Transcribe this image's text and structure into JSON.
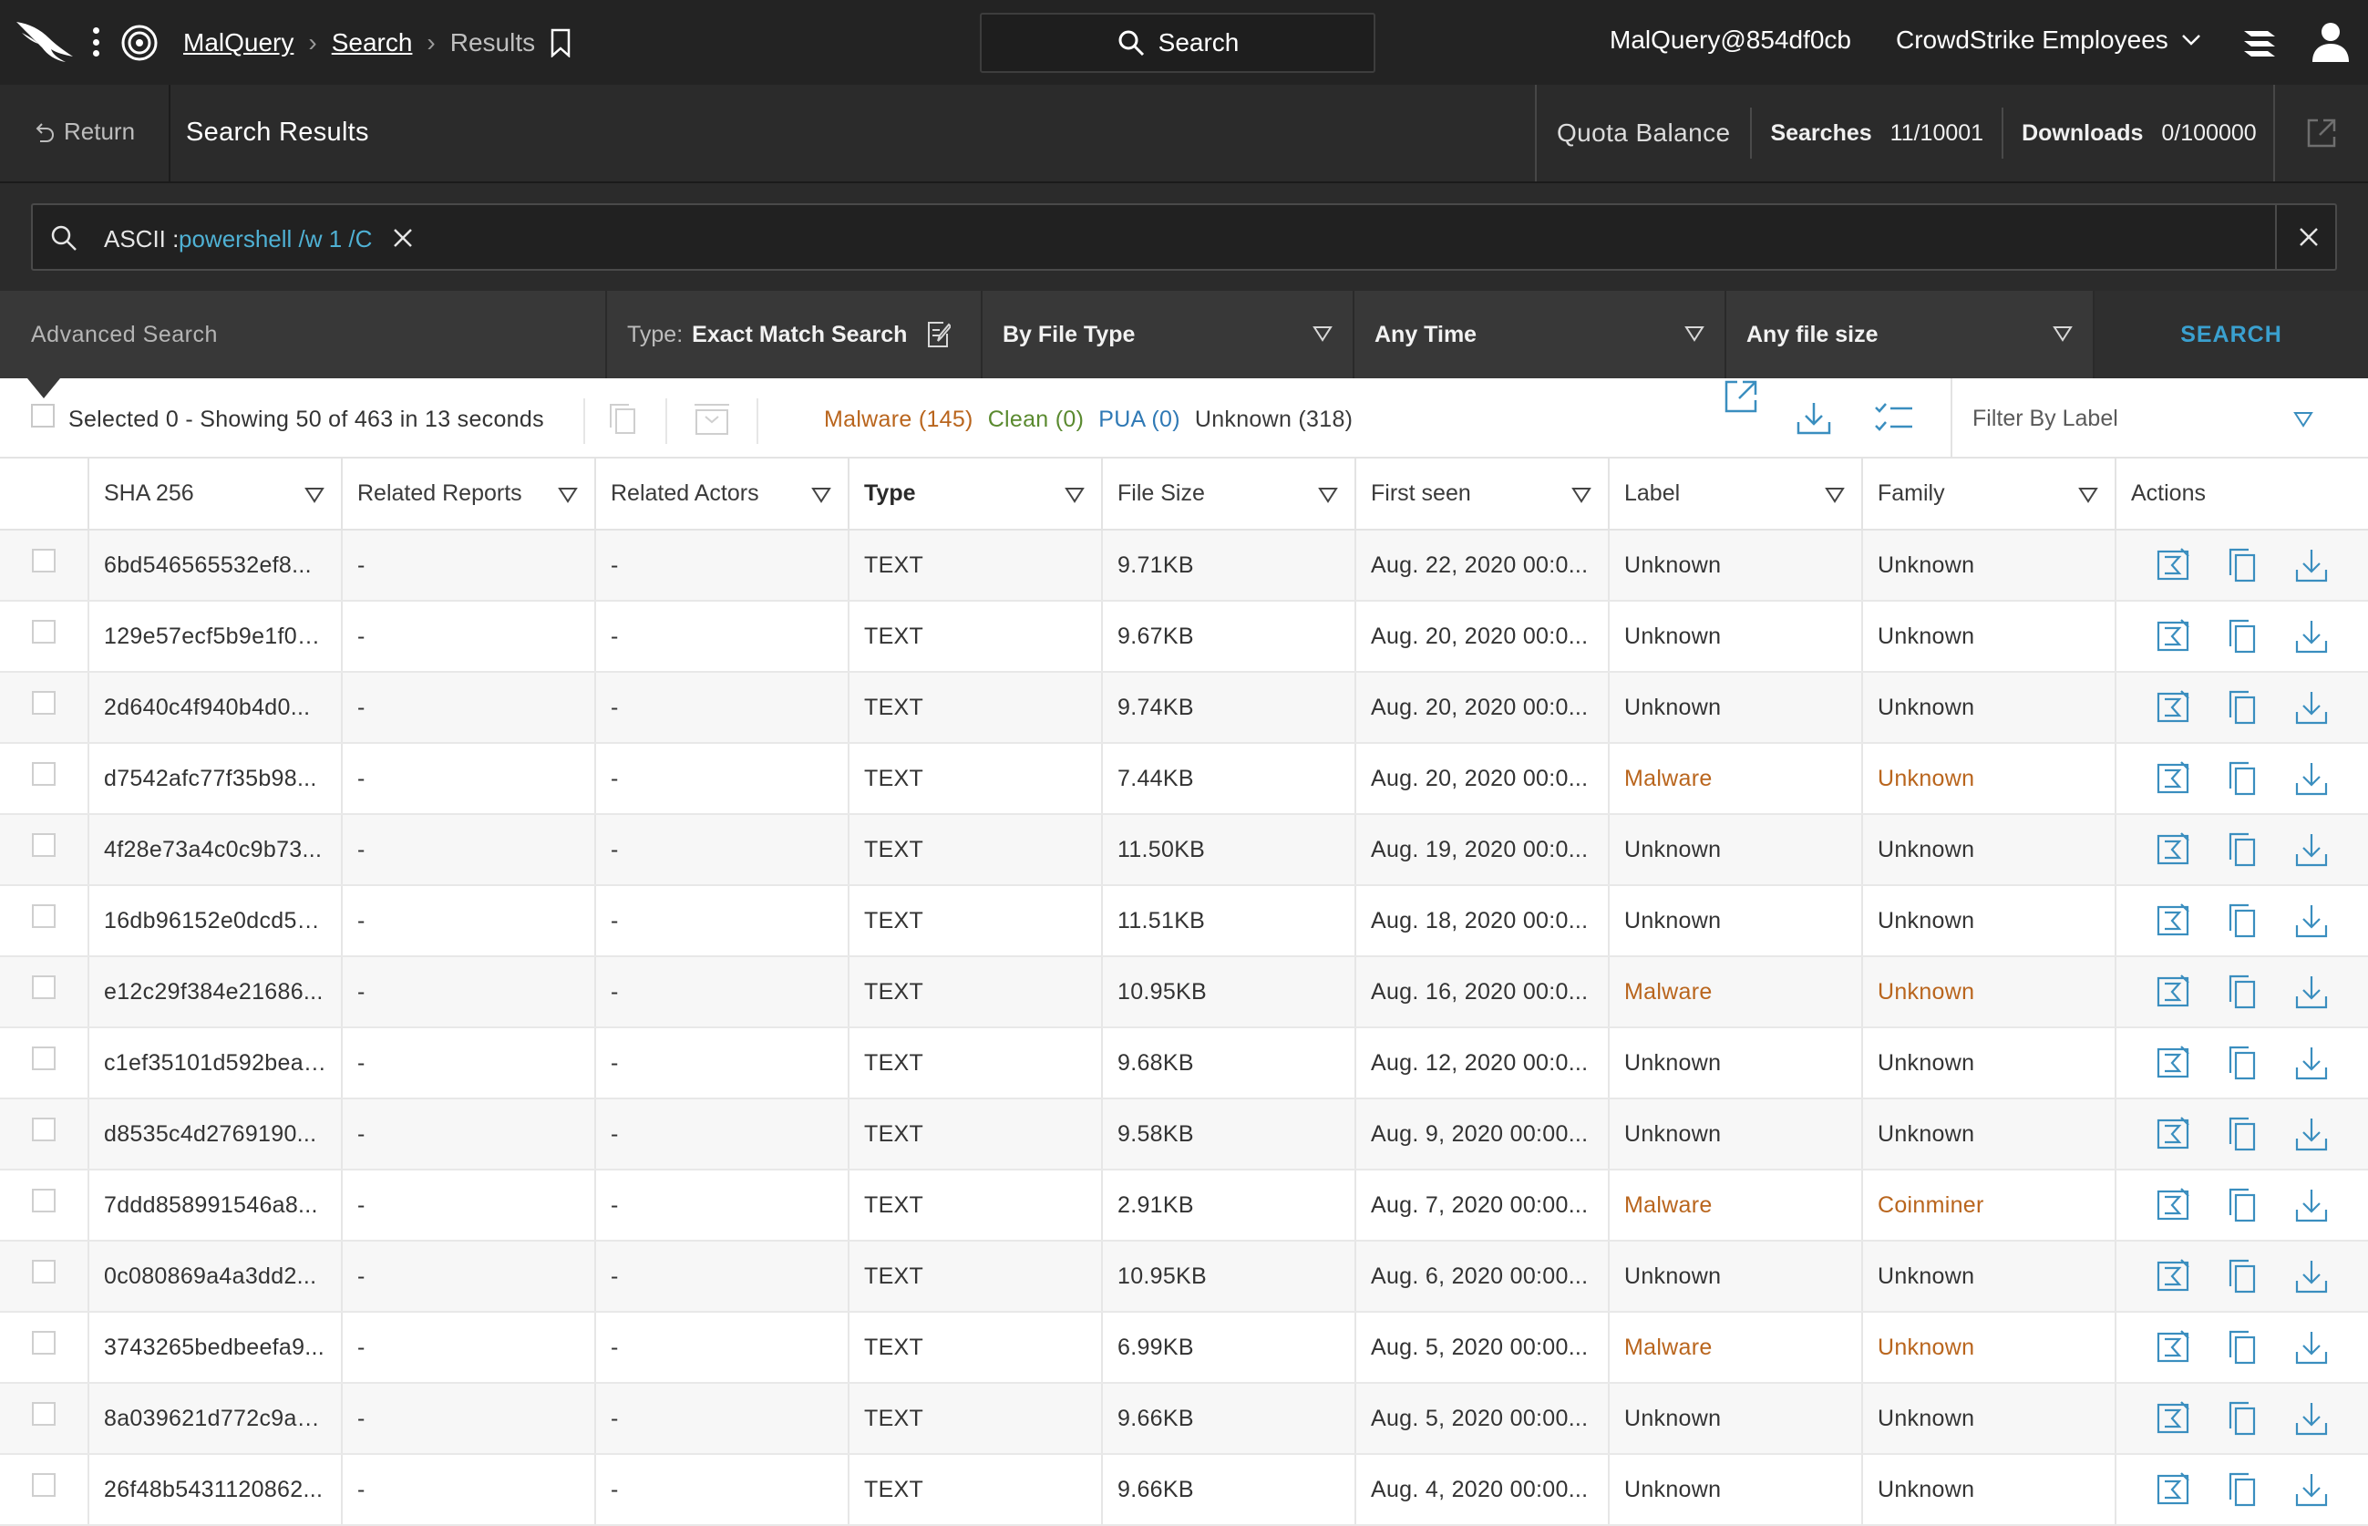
{
  "nav": {
    "breadcrumb_root": "MalQuery",
    "breadcrumb_search": "Search",
    "breadcrumb_current": "Results",
    "search_button": "Search",
    "account": "MalQuery@854df0cb",
    "org": "CrowdStrike Employees"
  },
  "subheader": {
    "return_label": "Return",
    "title": "Search Results",
    "quota_title": "Quota Balance",
    "searches_label": "Searches",
    "searches_value": "11/10001",
    "downloads_label": "Downloads",
    "downloads_value": "0/100000"
  },
  "query": {
    "prefix": "ASCII :",
    "value": "powershell /w 1 /C"
  },
  "filters": {
    "advanced_label": "Advanced Search",
    "type_label": "Type:",
    "type_value": "Exact Match Search",
    "file_type": "By File Type",
    "time": "Any Time",
    "size": "Any file size",
    "search_button": "SEARCH"
  },
  "toolbar": {
    "selection_text": "Selected 0 - Showing 50 of 463 in 13 seconds",
    "malware": "Malware (145)",
    "clean": "Clean (0)",
    "pua": "PUA (0)",
    "unknown": "Unknown (318)",
    "filter_label": "Filter By Label"
  },
  "table": {
    "columns": [
      "SHA 256",
      "Related Reports",
      "Related Actors",
      "Type",
      "File Size",
      "First seen",
      "Label",
      "Family",
      "Actions"
    ],
    "rows": [
      {
        "sha": "6bd546565532ef8...",
        "reports": "-",
        "actors": "-",
        "type": "TEXT",
        "size": "9.71KB",
        "seen": "Aug. 22, 2020 00:0...",
        "label": "Unknown",
        "family": "Unknown",
        "malware": false
      },
      {
        "sha": "129e57ecf5b9e1f0e...",
        "reports": "-",
        "actors": "-",
        "type": "TEXT",
        "size": "9.67KB",
        "seen": "Aug. 20, 2020 00:0...",
        "label": "Unknown",
        "family": "Unknown",
        "malware": false
      },
      {
        "sha": "2d640c4f940b4d0...",
        "reports": "-",
        "actors": "-",
        "type": "TEXT",
        "size": "9.74KB",
        "seen": "Aug. 20, 2020 00:0...",
        "label": "Unknown",
        "family": "Unknown",
        "malware": false
      },
      {
        "sha": "d7542afc77f35b98...",
        "reports": "-",
        "actors": "-",
        "type": "TEXT",
        "size": "7.44KB",
        "seen": "Aug. 20, 2020 00:0...",
        "label": "Malware",
        "family": "Unknown",
        "malware": true
      },
      {
        "sha": "4f28e73a4c0c9b73...",
        "reports": "-",
        "actors": "-",
        "type": "TEXT",
        "size": "11.50KB",
        "seen": "Aug. 19, 2020 00:0...",
        "label": "Unknown",
        "family": "Unknown",
        "malware": false
      },
      {
        "sha": "16db96152e0dcd59...",
        "reports": "-",
        "actors": "-",
        "type": "TEXT",
        "size": "11.51KB",
        "seen": "Aug. 18, 2020 00:0...",
        "label": "Unknown",
        "family": "Unknown",
        "malware": false
      },
      {
        "sha": "e12c29f384e21686...",
        "reports": "-",
        "actors": "-",
        "type": "TEXT",
        "size": "10.95KB",
        "seen": "Aug. 16, 2020 00:0...",
        "label": "Malware",
        "family": "Unknown",
        "malware": true
      },
      {
        "sha": "c1ef35101d592bea8...",
        "reports": "-",
        "actors": "-",
        "type": "TEXT",
        "size": "9.68KB",
        "seen": "Aug. 12, 2020 00:0...",
        "label": "Unknown",
        "family": "Unknown",
        "malware": false
      },
      {
        "sha": "d8535c4d2769190...",
        "reports": "-",
        "actors": "-",
        "type": "TEXT",
        "size": "9.58KB",
        "seen": "Aug. 9, 2020 00:00...",
        "label": "Unknown",
        "family": "Unknown",
        "malware": false
      },
      {
        "sha": "7ddd858991546a8...",
        "reports": "-",
        "actors": "-",
        "type": "TEXT",
        "size": "2.91KB",
        "seen": "Aug. 7, 2020 00:00...",
        "label": "Malware",
        "family": "Coinminer",
        "malware": true
      },
      {
        "sha": "0c080869a4a3dd2...",
        "reports": "-",
        "actors": "-",
        "type": "TEXT",
        "size": "10.95KB",
        "seen": "Aug. 6, 2020 00:00...",
        "label": "Unknown",
        "family": "Unknown",
        "malware": false
      },
      {
        "sha": "3743265bedbeefa9...",
        "reports": "-",
        "actors": "-",
        "type": "TEXT",
        "size": "6.99KB",
        "seen": "Aug. 5, 2020 00:00...",
        "label": "Malware",
        "family": "Unknown",
        "malware": true
      },
      {
        "sha": "8a039621d772c9a3...",
        "reports": "-",
        "actors": "-",
        "type": "TEXT",
        "size": "9.66KB",
        "seen": "Aug. 5, 2020 00:00...",
        "label": "Unknown",
        "family": "Unknown",
        "malware": false
      },
      {
        "sha": "26f48b5431120862...",
        "reports": "-",
        "actors": "-",
        "type": "TEXT",
        "size": "9.66KB",
        "seen": "Aug. 4, 2020 00:00...",
        "label": "Unknown",
        "family": "Unknown",
        "malware": false
      }
    ]
  },
  "icons": {
    "brand": "falcon-logo-icon",
    "app": "malquery-app-icon",
    "bookmark": "bookmark-icon",
    "row_actions": [
      "analyze-icon",
      "copy-icon",
      "download-icon"
    ]
  },
  "colors": {
    "malware": "#b9651d",
    "clean": "#5a8a2f",
    "pua": "#2f79b5",
    "accent": "#3aa0cf",
    "query_value": "#4fb1d4"
  }
}
